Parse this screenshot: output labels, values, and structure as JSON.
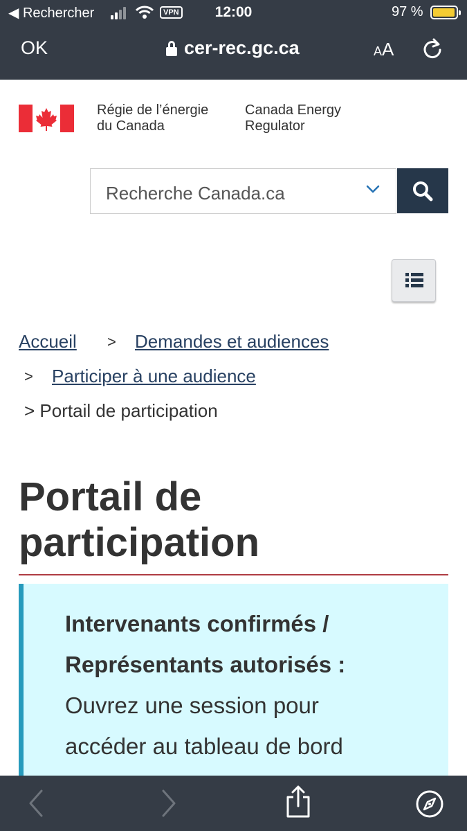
{
  "status_bar": {
    "back_label": "◀ Rechercher",
    "time": "12:00",
    "vpn": "VPN",
    "battery_percent": "97 %",
    "battery_level": 0.97
  },
  "browser": {
    "done_label": "OK",
    "url": "cer-rec.gc.ca",
    "text_size_small": "A",
    "text_size_large": "A"
  },
  "header": {
    "signature_fr_line1": "Régie de l’énergie",
    "signature_fr_line2": "du Canada",
    "signature_en_line1": "Canada Energy",
    "signature_en_line2": "Regulator"
  },
  "search": {
    "placeholder": "Recherche Canada.ca"
  },
  "breadcrumb": {
    "items": [
      {
        "label": "Accueil"
      },
      {
        "label": "Demandes et audiences"
      },
      {
        "label": "Participer à une audience"
      },
      {
        "label": "Portail de participation"
      }
    ],
    "separator": ">"
  },
  "main": {
    "title_line1": "Portail de",
    "title_line2": "participation",
    "alert_bold_line1": "Intervenants confirmés /",
    "alert_bold_line2": "Représentants autorisés :",
    "alert_line1": "Ouvrez une session pour",
    "alert_line2": "accéder au tableau de bord"
  },
  "colors": {
    "chrome": "#353c46",
    "search_button": "#26374a",
    "link": "#284162",
    "title_rule": "#af3c43",
    "alert_bg": "#d7faff",
    "alert_border": "#269abc",
    "flag_red": "#eb2d37",
    "battery": "#f4cc33"
  },
  "icons": [
    "back-chevron-icon",
    "signal-icon",
    "wifi-icon",
    "lock-icon",
    "reload-icon",
    "chevron-down-icon",
    "search-icon",
    "list-menu-icon",
    "share-icon",
    "compass-icon",
    "forward-chevron-icon"
  ]
}
